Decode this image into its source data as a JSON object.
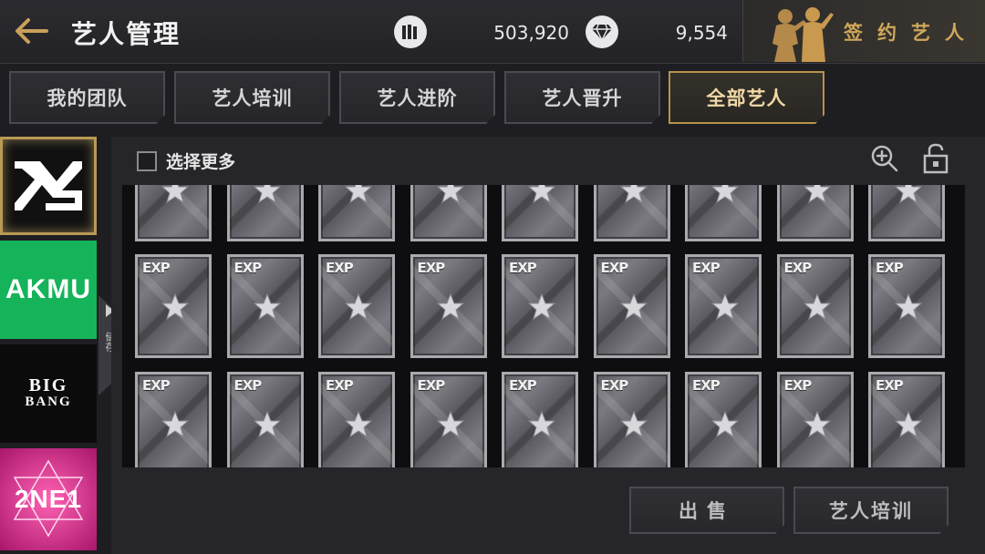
{
  "header": {
    "title": "艺人管理",
    "gold_value": "503,920",
    "gem_value": "9,554",
    "sign_label": "签约艺人"
  },
  "tabs": [
    {
      "label": "我的团队",
      "active": false
    },
    {
      "label": "艺人培训",
      "active": false
    },
    {
      "label": "艺人进阶",
      "active": false
    },
    {
      "label": "艺人晋升",
      "active": false
    },
    {
      "label": "全部艺人",
      "active": true
    }
  ],
  "sidebar": {
    "groups": [
      {
        "name": "YG"
      },
      {
        "name": "AKMU"
      },
      {
        "name": "BIG BANG"
      },
      {
        "name": "2NE1"
      }
    ],
    "handle_label": "储存"
  },
  "toolbar": {
    "select_more_label": "选择更多",
    "select_more_checked": false
  },
  "cards": {
    "label": "EXP",
    "columns": 9,
    "rows_visible": 3
  },
  "actions": {
    "sell_label": "出售",
    "train_label": "艺人培训"
  },
  "colors": {
    "accent_gold": "#b8924e",
    "akmu_green": "#15b35a",
    "ne1_pink": "#e3409a"
  }
}
